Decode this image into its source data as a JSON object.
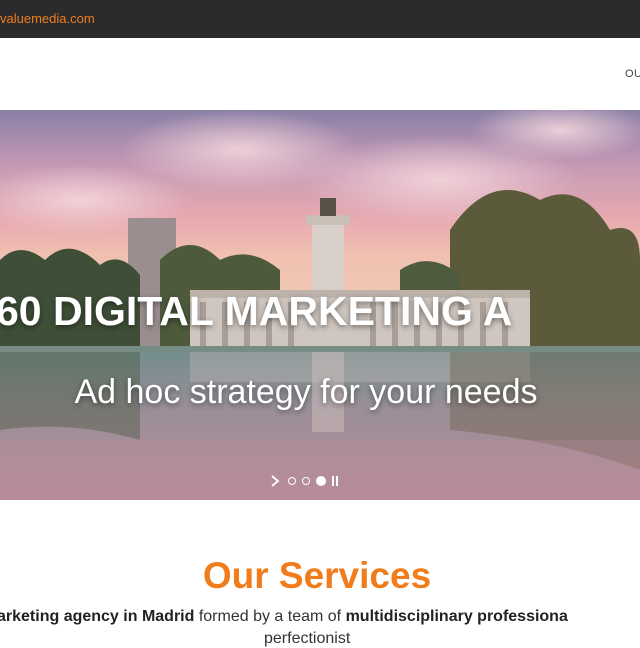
{
  "topbar": {
    "email": "valuemedia.com"
  },
  "header": {
    "nav_item": "OU"
  },
  "hero": {
    "title": "60 DIGITAL MARKETING A",
    "subtitle": "Ad hoc strategy for your needs",
    "slider": {
      "total_slides": 3,
      "active_slide": 3
    }
  },
  "services": {
    "title": "Our Services",
    "intro_part1": "arketing agency in Madrid",
    "intro_part2": " formed by a team of ",
    "intro_part3": "multidisciplinary professiona",
    "intro_line2": "perfectionist"
  },
  "colors": {
    "accent": "#f07c1b",
    "topbar": "#2b2b2e",
    "body_text": "#333333"
  }
}
